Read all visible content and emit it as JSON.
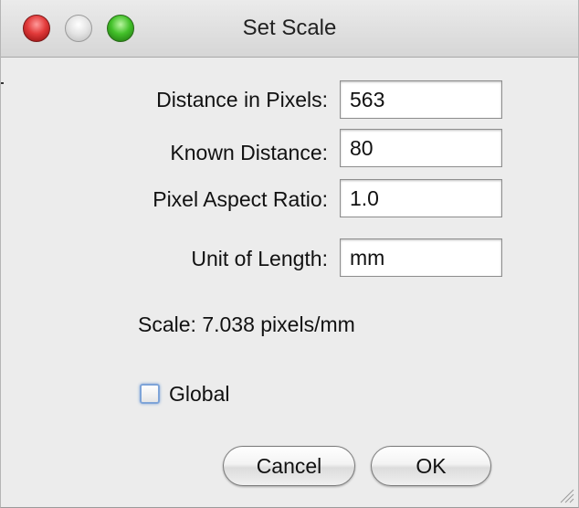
{
  "window": {
    "title": "Set Scale"
  },
  "fields": [
    {
      "label": "Distance in Pixels:",
      "value": "563"
    },
    {
      "label": "Known Distance:",
      "value": "80"
    },
    {
      "label": "Pixel Aspect Ratio:",
      "value": "1.0"
    },
    {
      "label": "Unit of Length:",
      "value": "mm"
    }
  ],
  "scale": {
    "text": "Scale: 7.038 pixels/mm"
  },
  "global": {
    "label": "Global",
    "checked": false
  },
  "buttons": {
    "cancel": "Cancel",
    "ok": "OK"
  },
  "icons": {
    "close": "close-icon",
    "minimize": "minimize-icon",
    "zoom": "zoom-icon",
    "resize": "resize-grip-icon"
  },
  "colors": {
    "close": "#e23a3a",
    "minimize": "#d8d8d8",
    "zoom": "#43c12a",
    "focus": "#7ea4d8"
  }
}
